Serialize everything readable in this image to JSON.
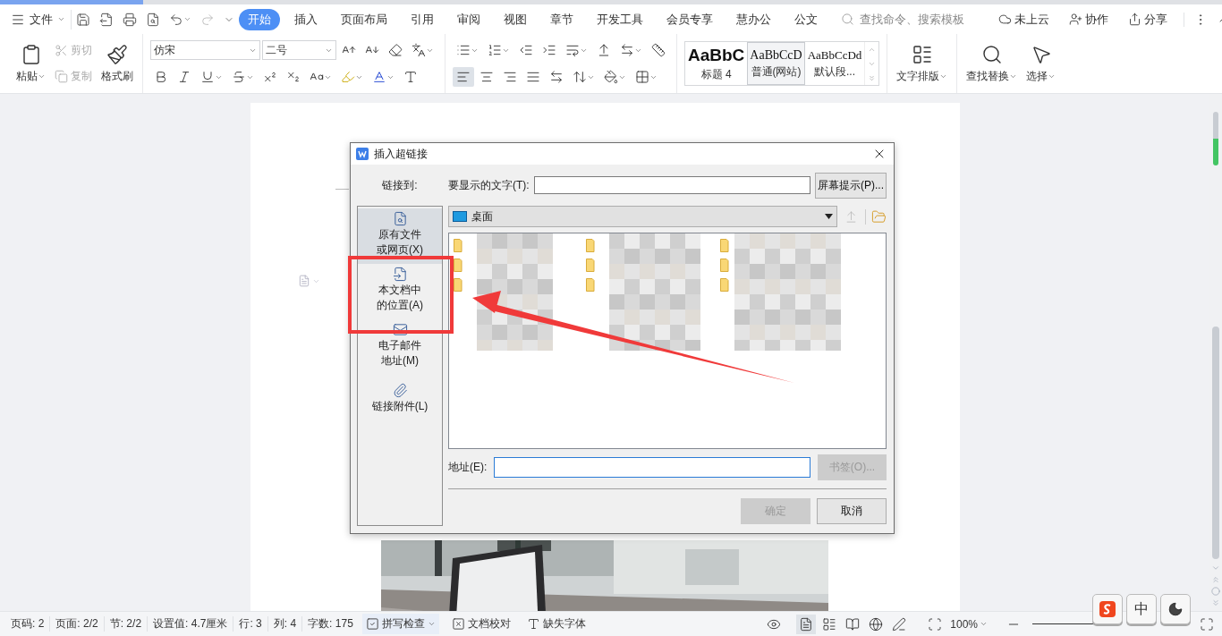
{
  "menu_button": "文件",
  "quick_access": {
    "redo_disabled": true
  },
  "tabs": [
    {
      "label": "开始",
      "selected": true
    },
    {
      "label": "插入",
      "selected": false
    },
    {
      "label": "页面布局",
      "selected": false
    },
    {
      "label": "引用",
      "selected": false
    },
    {
      "label": "审阅",
      "selected": false
    },
    {
      "label": "视图",
      "selected": false
    },
    {
      "label": "章节",
      "selected": false
    },
    {
      "label": "开发工具",
      "selected": false
    },
    {
      "label": "会员专享",
      "selected": false
    },
    {
      "label": "慧办公",
      "selected": false
    },
    {
      "label": "公文",
      "selected": false
    }
  ],
  "search": {
    "placeholder": "查找命令、搜索模板"
  },
  "top_actions": [
    {
      "kind": "cloud",
      "label": "未上云"
    },
    {
      "kind": "collaborate",
      "label": "协作"
    },
    {
      "kind": "share",
      "label": "分享"
    }
  ],
  "clipboard": {
    "paste": "粘贴",
    "cut": {
      "label": "剪切",
      "disabled": true
    },
    "copy": {
      "label": "复制",
      "disabled": true
    },
    "format_painter": "格式刷"
  },
  "font": {
    "name": "仿宋",
    "size": "二号"
  },
  "alignments": [
    {
      "kind": "left",
      "selected": true
    },
    {
      "kind": "center",
      "selected": false
    },
    {
      "kind": "right",
      "selected": false
    },
    {
      "kind": "justify",
      "selected": false
    },
    {
      "kind": "distributed",
      "selected": false
    }
  ],
  "styles": [
    {
      "kind": "heading",
      "preview": "AaBbC",
      "name": "标题 4",
      "selected": false
    },
    {
      "kind": "web",
      "preview": "AaBbCcD",
      "name": "普通(网站)",
      "selected": true
    },
    {
      "kind": "default",
      "preview": "AaBbCcDd",
      "name": "默认段...",
      "selected": false
    }
  ],
  "text_layout": "文字排版",
  "find_replace": "查找替换",
  "select": "选择",
  "dialog": {
    "title": "插入超链接",
    "link_to_label": "链接到:",
    "display_text_label": "要显示的文字(T):",
    "screen_tip_button": "屏幕提示(P)...",
    "targets": [
      {
        "kind": "file",
        "lines": [
          "原有文件",
          "或网页(X)"
        ],
        "selected": true
      },
      {
        "kind": "place",
        "lines": [
          "本文档中",
          "的位置(A)"
        ],
        "selected": false
      },
      {
        "kind": "email",
        "lines": [
          "电子邮件",
          "地址(M)"
        ],
        "selected": false
      },
      {
        "kind": "attachment",
        "lines": [
          "链接附件(L)"
        ],
        "selected": false
      }
    ],
    "folder": "桌面",
    "files": [
      {
        "kind": "folder"
      },
      {
        "kind": "folder"
      },
      {
        "kind": "folder"
      },
      {
        "kind": "folder"
      },
      {
        "kind": "folder"
      },
      {
        "kind": "folder"
      },
      {
        "kind": "folder"
      },
      {
        "kind": "folder"
      },
      {
        "kind": "folder"
      }
    ],
    "address_label": "地址(E):",
    "bookmark_button": {
      "label": "书签(O)...",
      "disabled": true
    },
    "ok_button": {
      "label": "确定",
      "disabled": true
    },
    "cancel_button": {
      "label": "取消",
      "disabled": false
    }
  },
  "status_items": [
    "页码: 2",
    "页面: 2/2",
    "节: 2/2",
    "设置值: 4.7厘米",
    "行: 3",
    "列: 4",
    "字数: 175"
  ],
  "spell_check": "拼写检查",
  "proofread": "文档校对",
  "missing_font": "缺失字体",
  "views": [
    {
      "kind": "page",
      "selected": true
    },
    {
      "kind": "outline",
      "selected": false
    },
    {
      "kind": "read",
      "selected": false
    },
    {
      "kind": "web",
      "selected": false
    },
    {
      "kind": "write",
      "selected": false
    }
  ],
  "zoom": "100%",
  "ime": {
    "mode": "中"
  }
}
